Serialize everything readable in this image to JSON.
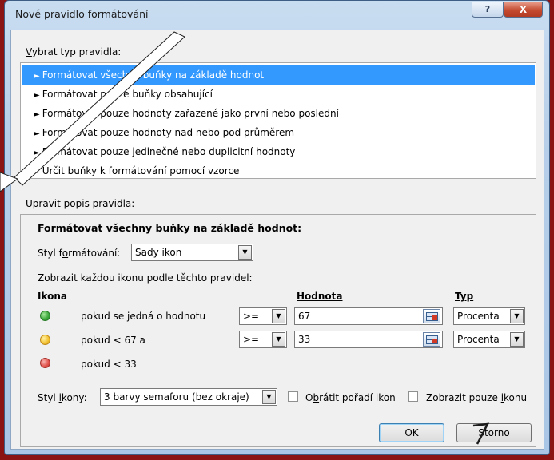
{
  "window": {
    "title": "Nové pravidlo formátování",
    "help_glyph": "?",
    "close_glyph": "X"
  },
  "select_rule_type": {
    "label_pre": "V",
    "label_rest": "ybrat typ pravidla:",
    "items": [
      "Formátovat všechny buňky na základě hodnot",
      "Formátovat pouze buňky obsahující",
      "Formátovat pouze hodnoty zařazené jako první nebo poslední",
      "Formátovat pouze hodnoty nad nebo pod průměrem",
      "Formátovat pouze jedinečné nebo duplicitní hodnoty",
      "Určit buňky k formátování pomocí vzorce"
    ],
    "selected_index": 0
  },
  "edit_description": {
    "label_pre": "U",
    "label_rest": "pravit popis pravidla:",
    "heading": "Formátovat všechny buňky na základě hodnot:",
    "format_style": {
      "label_a": "Styl f",
      "label_u": "o",
      "label_b": "rmátování:",
      "value": "Sady ikon"
    },
    "instructions": "Zobrazit každou ikonu podle těchto pravidel:",
    "columns": {
      "icon": "Ikona",
      "value": "Hodnota",
      "type": "Typ"
    },
    "rules": [
      {
        "icon_color": "#3aa63a",
        "text": "pokud se jedná o hodnotu",
        "operator": ">=",
        "value": "67",
        "type": "Procenta"
      },
      {
        "icon_color": "#f2c12e",
        "text": "pokud < 67 a",
        "operator": ">=",
        "value": "33",
        "type": "Procenta"
      },
      {
        "icon_color": "#e0504a",
        "text": "pokud < 33"
      }
    ],
    "icon_style": {
      "label_a": "Styl ",
      "label_u": "i",
      "label_b": "kony:",
      "value": "3 barvy semaforu (bez okraje)"
    },
    "reverse_order": {
      "label_a": "O",
      "label_u": "b",
      "label_b": "rátit pořadí ikon",
      "checked": false
    },
    "show_icon_only": {
      "label_a": "Zobrazit pouze ",
      "label_u": "i",
      "label_b": "konu",
      "checked": false
    }
  },
  "buttons": {
    "ok": "OK",
    "cancel": "Storno"
  },
  "arrow_glyph": "▼",
  "item_glyph": "►"
}
